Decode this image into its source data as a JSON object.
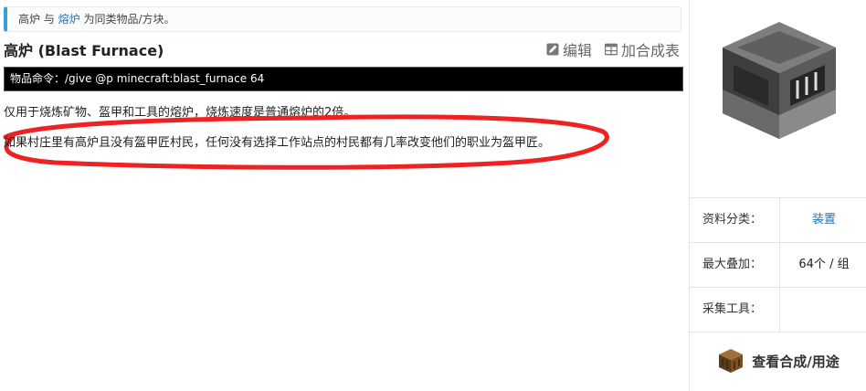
{
  "notice": {
    "item_a": "高炉",
    "sep": " 与 ",
    "item_b": "熔炉",
    "rest": " 为同类物品/方块。"
  },
  "title": "高炉 (Blast Furnace)",
  "actions": {
    "edit": "编辑",
    "add_to_table": "加合成表"
  },
  "command": "物品命令：/give @p minecraft:blast_furnace 64",
  "paragraphs": {
    "p1": "仅用于烧炼矿物、盔甲和工具的熔炉，烧炼速度是普通熔炉的2倍。",
    "p2": "如果村庄里有高炉且没有盔甲匠村民，任何没有选择工作站点的村民都有几率改变他们的职业为盔甲匠。"
  },
  "infobox": {
    "rows": [
      {
        "key": "资料分类：",
        "value": "装置"
      },
      {
        "key": "最大叠加：",
        "value": "64个 / 组"
      },
      {
        "key": "采集工具：",
        "value": ""
      }
    ],
    "recipe_button": "查看合成/用途"
  },
  "colors": {
    "accent": "#3aa0d8",
    "link": "#2a6fb0",
    "annotation": "#ee2222"
  }
}
